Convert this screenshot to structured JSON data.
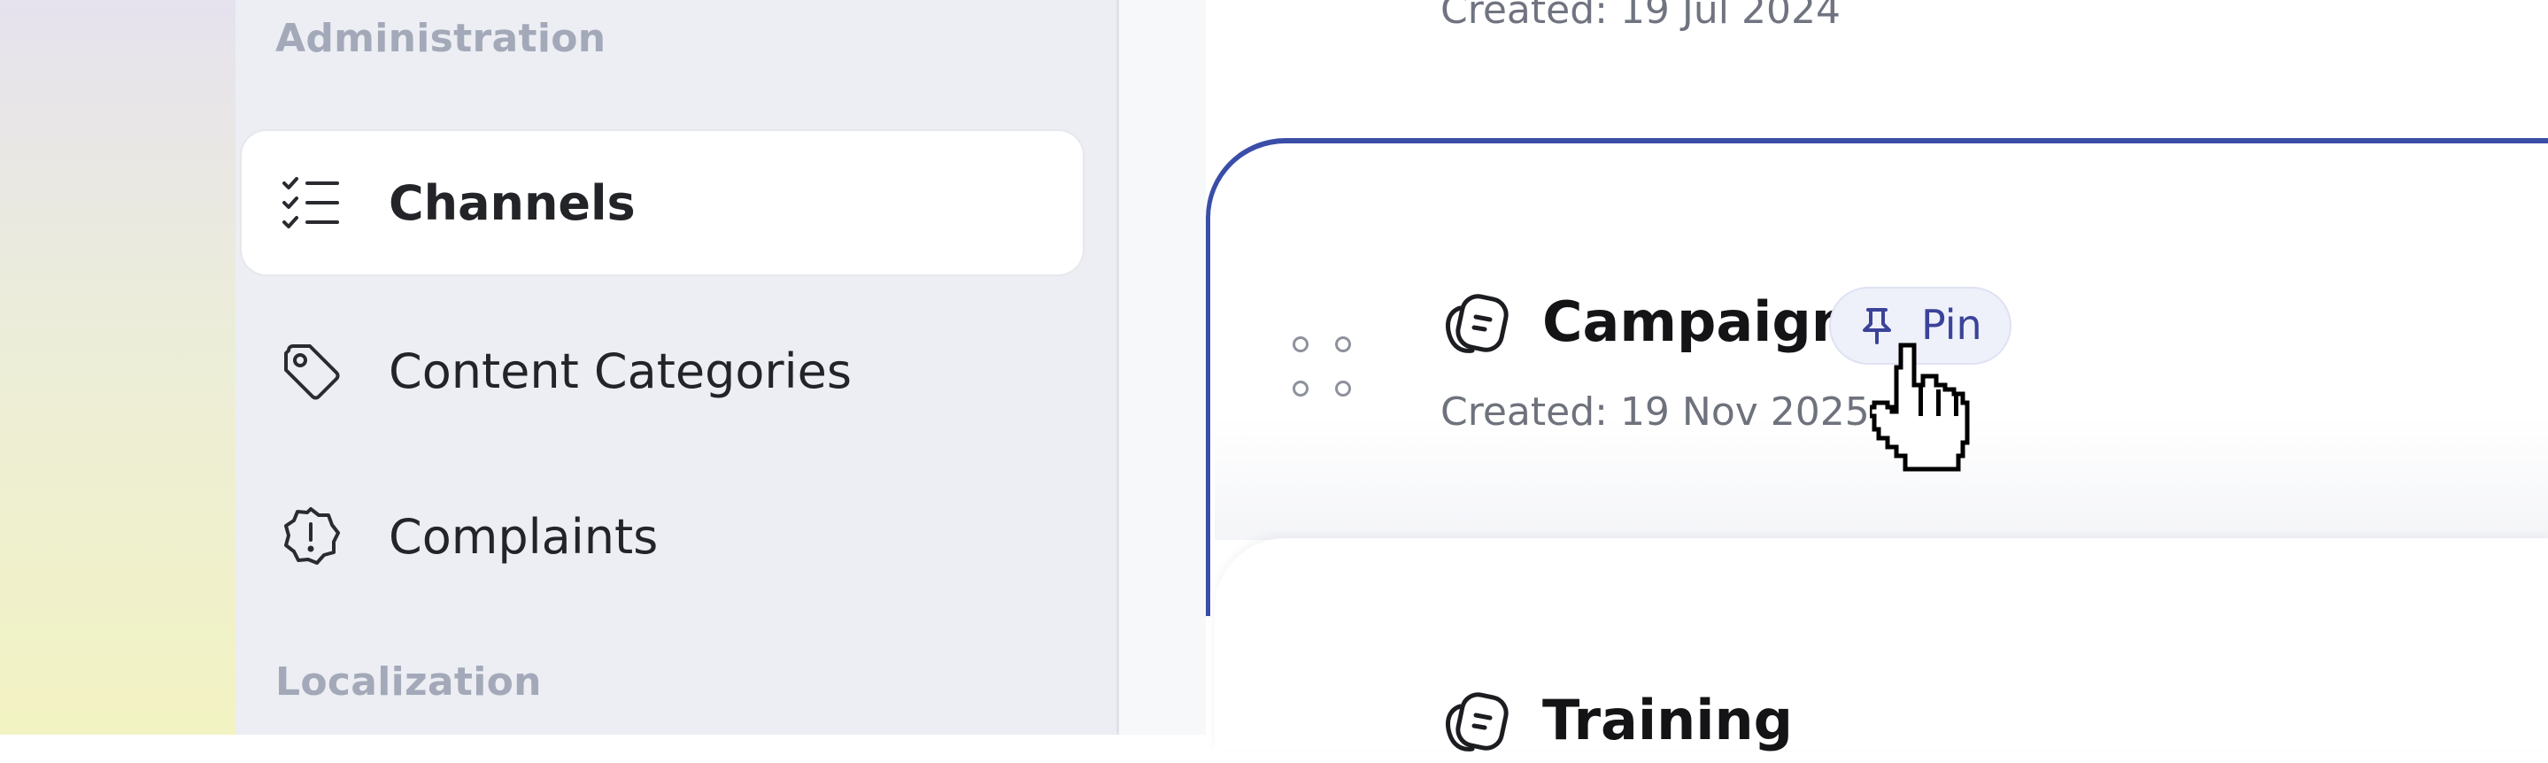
{
  "sidebar": {
    "sections": [
      {
        "label": "Administration"
      },
      {
        "label": "Localization"
      }
    ],
    "items": [
      {
        "label": "Channels",
        "icon": "checklist-icon",
        "active": true
      },
      {
        "label": "Content Categories",
        "icon": "tag-icon",
        "active": false
      },
      {
        "label": "Complaints",
        "icon": "alert-badge-icon",
        "active": false
      }
    ]
  },
  "list": {
    "previous_item": {
      "created": "Created: 19 Jul 2024"
    },
    "items": [
      {
        "title": "Campaign",
        "icon": "notes-stack-icon",
        "created": "Created: 19 Nov 2025",
        "pin_label": "Pin"
      },
      {
        "title": "Training",
        "icon": "notes-stack-icon"
      }
    ]
  },
  "colors": {
    "accent": "#3a4ea8",
    "pin_text": "#3b4399",
    "pin_bg": "#eef0fa",
    "sidebar_bg": "#eceef3",
    "section_label": "#a3a9b8"
  }
}
